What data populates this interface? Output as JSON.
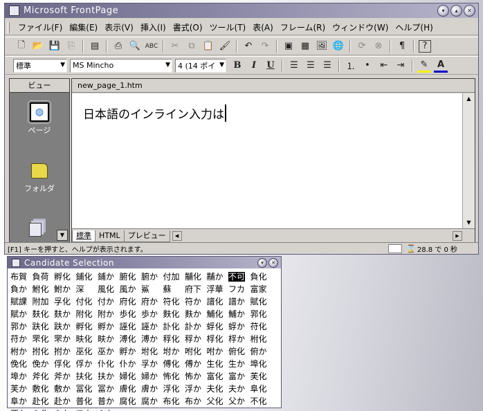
{
  "window": {
    "title": "Microsoft FrontPage",
    "buttons": [
      "▾",
      "▴",
      "✕"
    ]
  },
  "menu": [
    "ファイル(F)",
    "編集(E)",
    "表示(V)",
    "挿入(I)",
    "書式(O)",
    "ツール(T)",
    "表(A)",
    "フレーム(R)",
    "ウィンドウ(W)",
    "ヘルプ(H)"
  ],
  "toolbar2": {
    "style": "標準",
    "font": "MS Mincho",
    "size": "4 (14 ポイ"
  },
  "views": {
    "header": "ビュー",
    "items": [
      "ページ",
      "フォルダ"
    ]
  },
  "editor": {
    "tab": "new_page_1.htm",
    "content": "日本語のインライン入力は",
    "bottom_tabs": [
      "標準",
      "HTML",
      "プレビュー"
    ]
  },
  "status": {
    "message": "[F1] キーを押すと、ヘルプが表示されます。",
    "time": "28.8 で 0 秒"
  },
  "candidate": {
    "title": "Candidate Selection",
    "items": [
      "布賀",
      "負荷",
      "孵化",
      "鋪化",
      "鋪か",
      "腑化",
      "腑か",
      "付加",
      "黼化",
      "黼か",
      "不可",
      "負化",
      "負か",
      "鮒化",
      "鮒か",
      "深",
      "風化",
      "風か",
      "鯊",
      "蘇",
      "府下",
      "浮華",
      "フカ",
      "富家",
      "賦課",
      "附加",
      "孚化",
      "付化",
      "付か",
      "府化",
      "府か",
      "符化",
      "符か",
      "譜化",
      "譜か",
      "賦化",
      "賦か",
      "麸化",
      "麸か",
      "附化",
      "附か",
      "歩化",
      "歩か",
      "麩化",
      "麩か",
      "鯆化",
      "鯆か",
      "郛化",
      "郛か",
      "趺化",
      "趺か",
      "孵化",
      "孵か",
      "誣化",
      "誣か",
      "訃化",
      "訃か",
      "蜉化",
      "蜉か",
      "苻化",
      "苻か",
      "罘化",
      "罘か",
      "畉化",
      "畉か",
      "溥化",
      "溥か",
      "稃化",
      "稃か",
      "桴化",
      "桴か",
      "柎化",
      "柎か",
      "拊化",
      "拊か",
      "巫化",
      "巫か",
      "孵か",
      "坿化",
      "坿か",
      "咐化",
      "咐か",
      "俯化",
      "俯か",
      "俛化",
      "俛か",
      "俘化",
      "俘か",
      "仆化",
      "仆か",
      "孚か",
      "傅化",
      "傅か",
      "生化",
      "生か",
      "埠化",
      "埠か",
      "斧化",
      "斧か",
      "扶化",
      "扶か",
      "婦化",
      "婦か",
      "怖化",
      "怖か",
      "富化",
      "富か",
      "芙化",
      "芙か",
      "敷化",
      "敷か",
      "冨化",
      "冨か",
      "膚化",
      "膚か",
      "浮化",
      "浮か",
      "夫化",
      "夫か",
      "阜化",
      "阜か",
      "赴化",
      "赴か",
      "普化",
      "普か",
      "腐化",
      "腐か",
      "布化",
      "布か",
      "父化",
      "父か",
      "不化",
      "不か",
      "ふ化",
      "ふか",
      "フカ",
      "ふか"
    ],
    "selected_index": 10
  }
}
